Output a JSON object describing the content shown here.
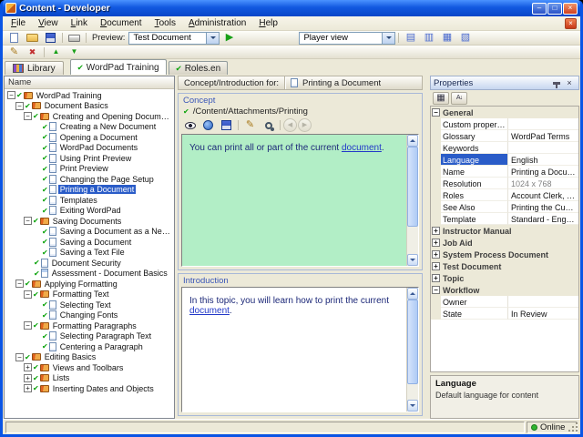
{
  "glyphs": {
    "check": "✔"
  },
  "colors": {
    "selection_blue": "#2A5CC8",
    "concept_green": "#B2EEC6",
    "link_blue": "#2238C8",
    "online_green": "#2FB52F"
  },
  "titlebar": {
    "title": "Content - Developer",
    "buttons": [
      {
        "name": "minimize",
        "glyph": "–"
      },
      {
        "name": "maximize",
        "glyph": "□"
      },
      {
        "name": "close",
        "glyph": "×"
      }
    ]
  },
  "menubar": {
    "items": [
      "File",
      "View",
      "Link",
      "Document",
      "Tools",
      "Administration",
      "Help"
    ],
    "right_buttons": [
      {
        "name": "close-document",
        "glyph": "×"
      }
    ]
  },
  "toolbar1": {
    "left_icons": [
      {
        "name": "new-document"
      },
      {
        "name": "open-folder"
      },
      {
        "name": "save"
      },
      {
        "sep": true
      },
      {
        "name": "print"
      }
    ],
    "preview_label": "Preview:",
    "preview_value": "Test Document",
    "run_icons": [
      {
        "name": "run-preview",
        "glyph": "▶"
      }
    ],
    "view_combo_value": "Player view",
    "right_icons": [
      {
        "name": "player-view",
        "glyph": "▤"
      },
      {
        "name": "editor-view",
        "glyph": "▥"
      },
      {
        "name": "grid-view",
        "glyph": "▦"
      },
      {
        "name": "web-view",
        "glyph": "▧"
      }
    ]
  },
  "toolbar2": {
    "icons": [
      {
        "name": "edit-document",
        "glyph": "✎"
      },
      {
        "name": "delete-document",
        "glyph": "✖"
      },
      {
        "sep": true
      },
      {
        "name": "move-up",
        "glyph": "▲"
      },
      {
        "name": "move-down",
        "glyph": "▼"
      }
    ]
  },
  "tabrow": {
    "library_label": "Library",
    "tabs": [
      {
        "label": "WordPad Training",
        "active": true
      },
      {
        "label": "Roles.en",
        "active": false
      }
    ]
  },
  "tree": {
    "header": "Name",
    "items": [
      {
        "label": "WordPad Training",
        "depth": 0,
        "icon": "book",
        "expand": "open"
      },
      {
        "label": "Document Basics",
        "depth": 1,
        "icon": "book",
        "expand": "open"
      },
      {
        "label": "Creating and Opening Documents",
        "depth": 2,
        "icon": "book",
        "expand": "open"
      },
      {
        "label": "Creating a New Document",
        "depth": 3,
        "icon": "page"
      },
      {
        "label": "Opening a Document",
        "depth": 3,
        "icon": "page"
      },
      {
        "label": "WordPad Documents",
        "depth": 3,
        "icon": "page"
      },
      {
        "label": "Using Print Preview",
        "depth": 3,
        "icon": "page"
      },
      {
        "label": "Print Preview",
        "depth": 3,
        "icon": "page"
      },
      {
        "label": "Changing the Page Setup",
        "depth": 3,
        "icon": "page"
      },
      {
        "label": "Printing a Document",
        "depth": 3,
        "icon": "page",
        "selected": true
      },
      {
        "label": "Templates",
        "depth": 3,
        "icon": "page"
      },
      {
        "label": "Exiting WordPad",
        "depth": 3,
        "icon": "page"
      },
      {
        "label": "Saving Documents",
        "depth": 2,
        "icon": "book",
        "expand": "open"
      },
      {
        "label": "Saving a Document as a New File",
        "depth": 3,
        "icon": "page"
      },
      {
        "label": "Saving a Document",
        "depth": 3,
        "icon": "page"
      },
      {
        "label": "Saving a Text File",
        "depth": 3,
        "icon": "page"
      },
      {
        "label": "Document Security",
        "depth": 2,
        "icon": "page"
      },
      {
        "label": "Assessment - Document Basics",
        "depth": 2,
        "icon": "assessment"
      },
      {
        "label": "Applying Formatting",
        "depth": 1,
        "icon": "book",
        "expand": "open"
      },
      {
        "label": "Formatting Text",
        "depth": 2,
        "icon": "book",
        "expand": "open"
      },
      {
        "label": "Selecting Text",
        "depth": 3,
        "icon": "page"
      },
      {
        "label": "Changing Fonts",
        "depth": 3,
        "icon": "page"
      },
      {
        "label": "Formatting Paragraphs",
        "depth": 2,
        "icon": "book",
        "expand": "open"
      },
      {
        "label": "Selecting Paragraph Text",
        "depth": 3,
        "icon": "page"
      },
      {
        "label": "Centering a Paragraph",
        "depth": 3,
        "icon": "page"
      },
      {
        "label": "Editing Basics",
        "depth": 1,
        "icon": "book",
        "expand": "open"
      },
      {
        "label": "Views and Toolbars",
        "depth": 2,
        "icon": "book",
        "expand": "closed"
      },
      {
        "label": "Lists",
        "depth": 2,
        "icon": "book",
        "expand": "closed"
      },
      {
        "label": "Inserting Dates and Objects",
        "depth": 2,
        "icon": "book",
        "expand": "closed"
      }
    ]
  },
  "center": {
    "header_label": "Concept/Introduction for:",
    "header_value": "Printing a Document",
    "concept": {
      "label": "Concept",
      "path": "/Content/Attachments/Printing",
      "toolbar_icons": [
        {
          "name": "preview-eye"
        },
        {
          "name": "web-globe"
        },
        {
          "name": "save-attachment"
        },
        {
          "sep": true
        },
        {
          "name": "edit-pencil",
          "glyph": "✎"
        },
        {
          "name": "zoom"
        },
        {
          "sep": true
        },
        {
          "name": "nav-previous",
          "glyph": "◀",
          "round": true,
          "disabled": true
        },
        {
          "name": "nav-next",
          "glyph": "▶",
          "round": true,
          "disabled": true
        }
      ],
      "body_before": "You can print all or part of the current ",
      "body_link": "document",
      "body_after": "."
    },
    "introduction": {
      "label": "Introduction",
      "body_before": "In this topic, you will learn how to print the current ",
      "body_link": "document",
      "body_after": "."
    }
  },
  "properties": {
    "title": "Properties",
    "buttons": [
      {
        "name": "pin"
      },
      {
        "name": "close-properties",
        "glyph": "×"
      }
    ],
    "toolbar_icons": [
      {
        "name": "categorized",
        "glyph": "▦"
      },
      {
        "name": "sort-alphabetical",
        "glyph": "A↓"
      }
    ],
    "rows": [
      {
        "kind": "category",
        "label": "General",
        "expanded": true
      },
      {
        "kind": "item",
        "label": "Custom properties",
        "value": ""
      },
      {
        "kind": "item",
        "label": "Glossary",
        "value": "WordPad Terms"
      },
      {
        "kind": "item",
        "label": "Keywords",
        "value": ""
      },
      {
        "kind": "item",
        "label": "Language",
        "value": "English",
        "selected": true
      },
      {
        "kind": "item",
        "label": "Name",
        "value": "Printing a Document"
      },
      {
        "kind": "item",
        "label": "Resolution",
        "value": "1024 x 768",
        "muted": true
      },
      {
        "kind": "item",
        "label": "Roles",
        "value": "Account Clerk, Custome..."
      },
      {
        "kind": "item",
        "label": "See Also",
        "value": "Printing the Current Wor..."
      },
      {
        "kind": "item",
        "label": "Template",
        "value": "Standard - English"
      },
      {
        "kind": "category",
        "label": "Instructor Manual",
        "expanded": false
      },
      {
        "kind": "category",
        "label": "Job Aid",
        "expanded": false
      },
      {
        "kind": "category",
        "label": "System Process Document",
        "expanded": false
      },
      {
        "kind": "category",
        "label": "Test Document",
        "expanded": false
      },
      {
        "kind": "category",
        "label": "Topic",
        "expanded": false
      },
      {
        "kind": "category",
        "label": "Workflow",
        "expanded": true
      },
      {
        "kind": "item",
        "label": "Owner",
        "value": ""
      },
      {
        "kind": "item",
        "label": "State",
        "value": "In Review"
      }
    ],
    "help_title": "Language",
    "help_text": "Default language for content"
  },
  "statusbar": {
    "online_label": "Online"
  }
}
